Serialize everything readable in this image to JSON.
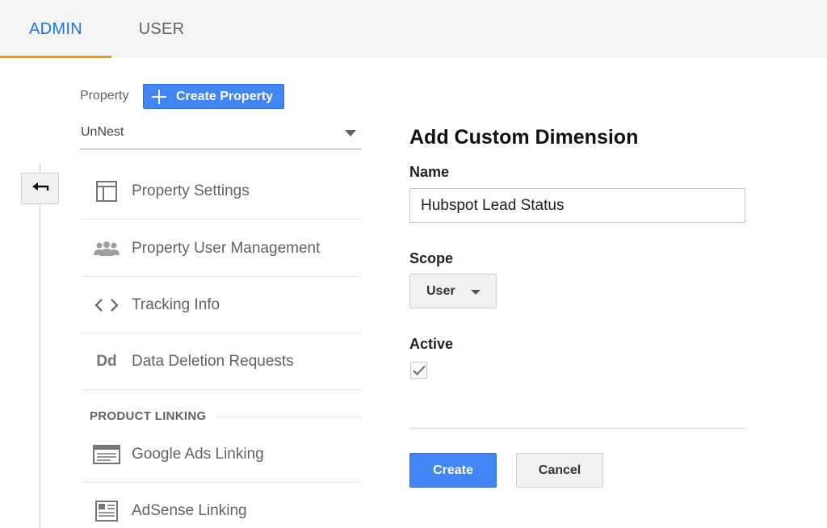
{
  "tabs": {
    "admin": "ADMIN",
    "user": "USER"
  },
  "property": {
    "label": "Property",
    "create_button": "Create Property",
    "selected": "UnNest"
  },
  "nav": {
    "items": [
      {
        "label": "Property Settings",
        "icon": "layout-icon"
      },
      {
        "label": "Property User Management",
        "icon": "people-icon"
      },
      {
        "label": "Tracking Info",
        "icon": "code-icon"
      },
      {
        "label": "Data Deletion Requests",
        "icon": "dd-icon"
      }
    ],
    "section": "PRODUCT LINKING",
    "dd_glyph": "Dd",
    "linking": [
      {
        "label": "Google Ads Linking",
        "icon": "ads-icon"
      },
      {
        "label": "AdSense Linking",
        "icon": "adsense-icon"
      }
    ]
  },
  "form": {
    "title": "Add Custom Dimension",
    "name_label": "Name",
    "name_value": "Hubspot Lead Status",
    "scope_label": "Scope",
    "scope_value": "User",
    "active_label": "Active",
    "active_checked": true,
    "create_button": "Create",
    "cancel_button": "Cancel"
  },
  "colors": {
    "accent": "#1a73e8",
    "button_blue": "#4285f4",
    "tab_underline": "#f29900"
  }
}
